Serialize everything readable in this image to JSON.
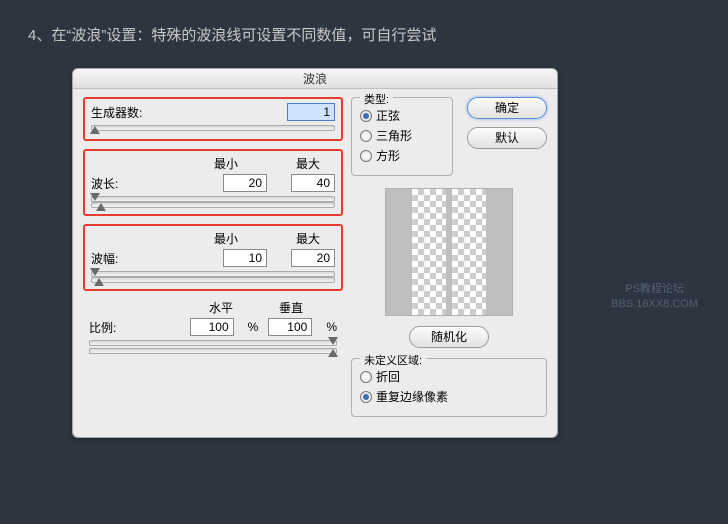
{
  "page": {
    "instruction": "4、在“波浪”设置：特殊的波浪线可设置不同数值，可自行尝试"
  },
  "dialog": {
    "title": "波浪",
    "generators": {
      "label": "生成器数:",
      "value": "1"
    },
    "headers": {
      "min": "最小",
      "max": "最大"
    },
    "wavelength": {
      "label": "波长:",
      "min": "20",
      "max": "40"
    },
    "amplitude": {
      "label": "波幅:",
      "min": "10",
      "max": "20"
    },
    "scale": {
      "label": "比例:",
      "h_label": "水平",
      "v_label": "垂直",
      "h": "100",
      "v": "100",
      "pct": "%"
    },
    "type": {
      "legend": "类型:",
      "sine": "正弦",
      "triangle": "三角形",
      "square": "方形"
    },
    "buttons": {
      "ok": "确定",
      "default": "默认",
      "randomize": "随机化"
    },
    "undefined_area": {
      "legend": "未定义区域:",
      "wrap": "折回",
      "repeat": "重复边缘像素"
    }
  },
  "watermark": {
    "line1": "PS教程论坛",
    "line2": "BBS.16XX8.COM"
  }
}
